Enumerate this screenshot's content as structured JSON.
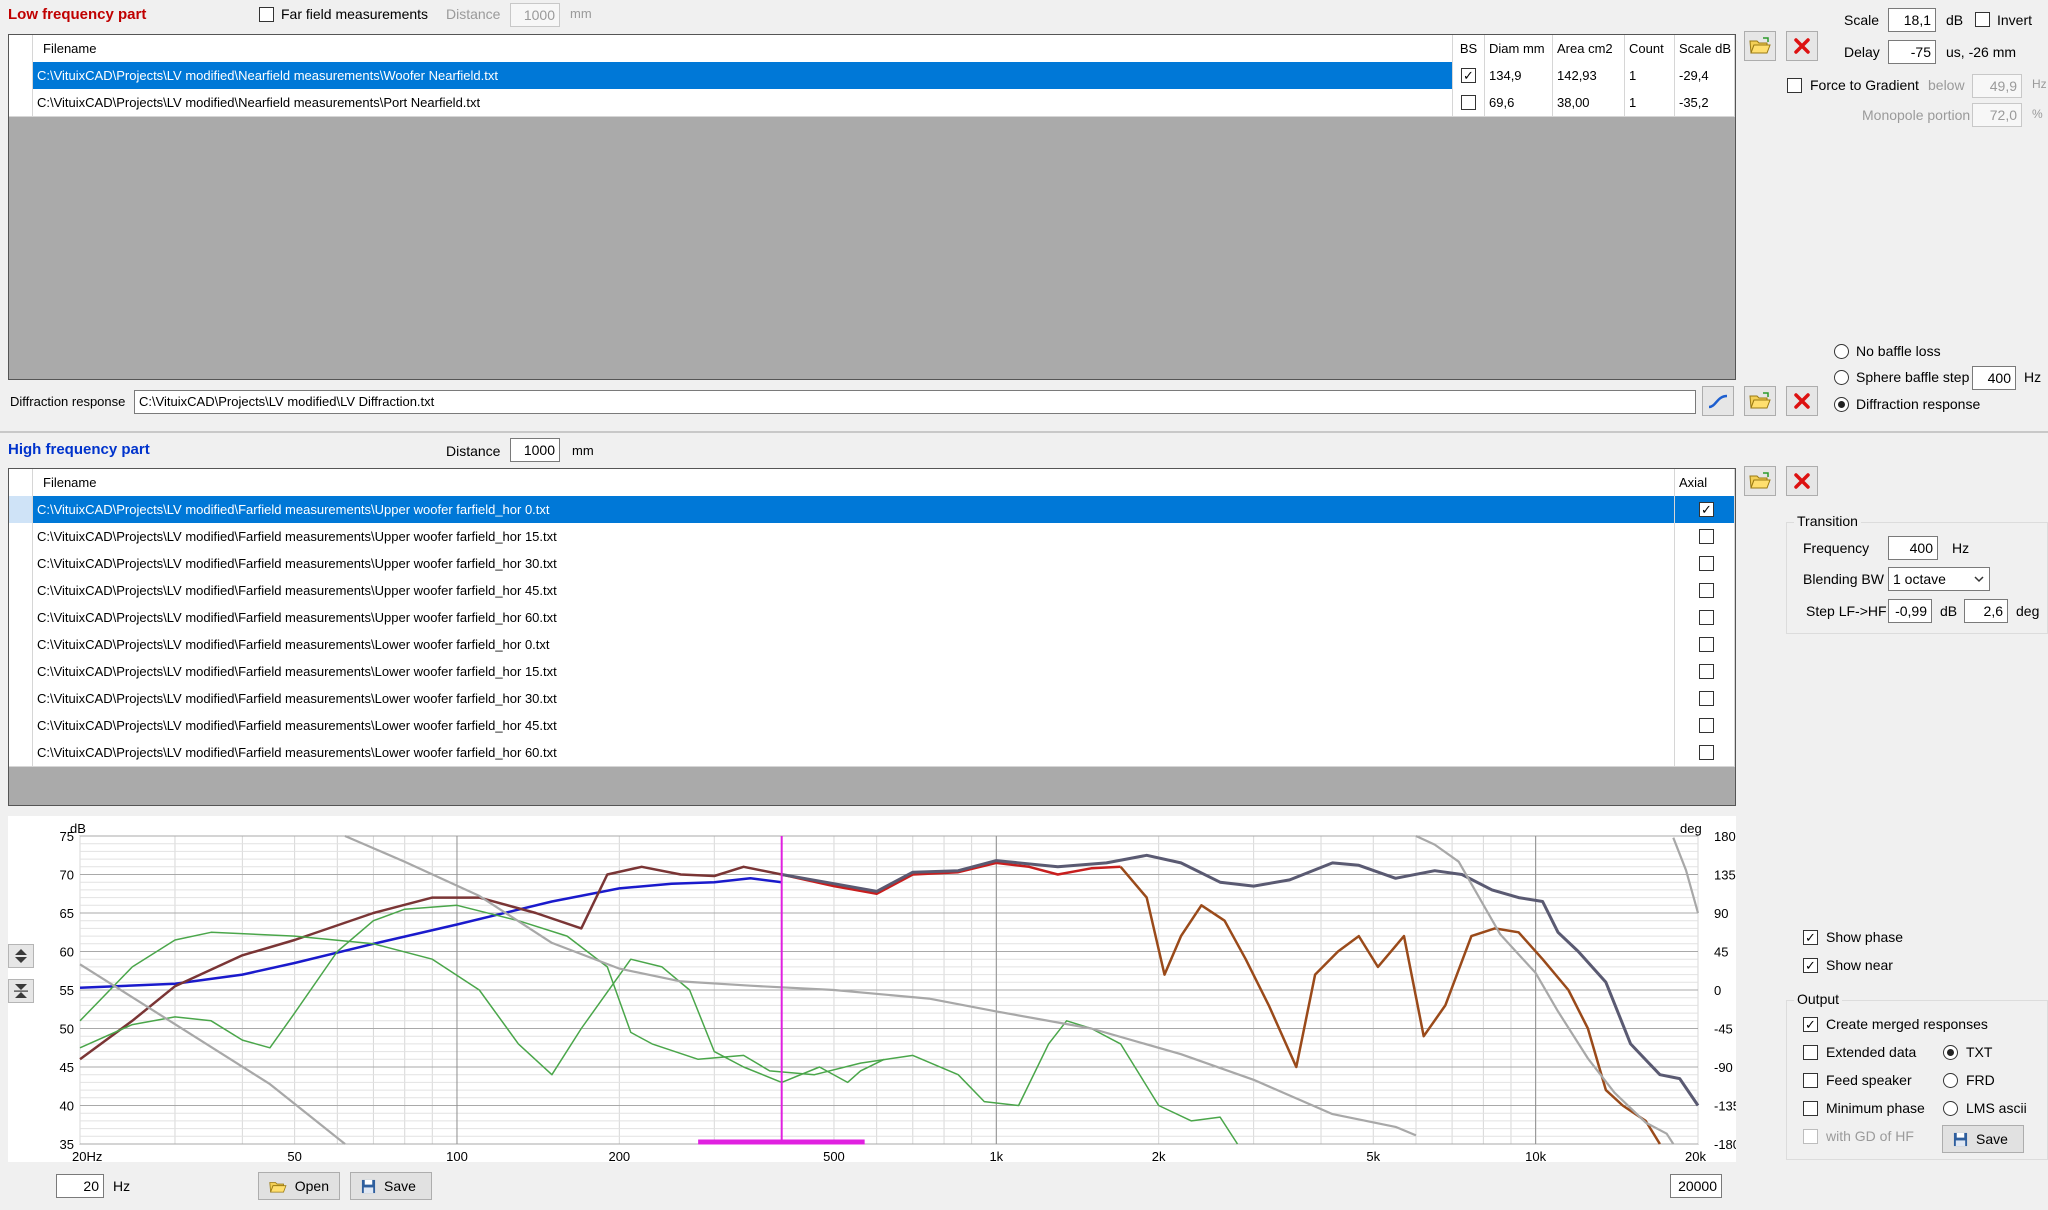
{
  "lf": {
    "title": "Low frequency part",
    "far_field_label": "Far field measurements",
    "distance_label": "Distance",
    "distance_value": "1000",
    "distance_unit": "mm",
    "columns": [
      "Filename",
      "BS",
      "Diam mm",
      "Area cm2",
      "Count",
      "Scale dB"
    ],
    "rows": [
      {
        "filename": "C:\\VituixCAD\\Projects\\LV modified\\Nearfield measurements\\Woofer Nearfield.txt",
        "bs": true,
        "diam": "134,9",
        "area": "142,93",
        "count": "1",
        "scale": "-29,4"
      },
      {
        "filename": "C:\\VituixCAD\\Projects\\LV modified\\Nearfield measurements\\Port Nearfield.txt",
        "bs": false,
        "diam": "69,6",
        "area": "38,00",
        "count": "1",
        "scale": "-35,2"
      }
    ],
    "diffraction_label": "Diffraction response",
    "diffraction_path": "C:\\VituixCAD\\Projects\\LV modified\\LV Diffraction.txt"
  },
  "scale": {
    "label": "Scale",
    "value": "18,1",
    "unit": "dB",
    "invert_label": "Invert",
    "delay_label": "Delay",
    "delay_value": "-75",
    "delay_unit": "us, -26 mm",
    "force_gradient_label": "Force to Gradient",
    "below_label": "below",
    "below_value": "49,9",
    "below_unit": "Hz",
    "monopole_label": "Monopole portion",
    "monopole_value": "72,0",
    "monopole_unit": "%"
  },
  "baffle": {
    "options": [
      "No baffle loss",
      "Sphere baffle step",
      "Diffraction response"
    ],
    "selected": 2,
    "sphere_value": "400",
    "sphere_unit": "Hz"
  },
  "hf": {
    "title": "High frequency part",
    "distance_label": "Distance",
    "distance_value": "1000",
    "distance_unit": "mm",
    "columns": [
      "Filename",
      "Axial"
    ],
    "rows": [
      {
        "filename": "C:\\VituixCAD\\Projects\\LV modified\\Farfield measurements\\Upper woofer farfield_hor 0.txt",
        "axial": true
      },
      {
        "filename": "C:\\VituixCAD\\Projects\\LV modified\\Farfield measurements\\Upper woofer farfield_hor 15.txt",
        "axial": false
      },
      {
        "filename": "C:\\VituixCAD\\Projects\\LV modified\\Farfield measurements\\Upper woofer farfield_hor 30.txt",
        "axial": false
      },
      {
        "filename": "C:\\VituixCAD\\Projects\\LV modified\\Farfield measurements\\Upper woofer farfield_hor 45.txt",
        "axial": false
      },
      {
        "filename": "C:\\VituixCAD\\Projects\\LV modified\\Farfield measurements\\Upper woofer farfield_hor 60.txt",
        "axial": false
      },
      {
        "filename": "C:\\VituixCAD\\Projects\\LV modified\\Farfield measurements\\Lower woofer farfield_hor 0.txt",
        "axial": false
      },
      {
        "filename": "C:\\VituixCAD\\Projects\\LV modified\\Farfield measurements\\Lower woofer farfield_hor 15.txt",
        "axial": false
      },
      {
        "filename": "C:\\VituixCAD\\Projects\\LV modified\\Farfield measurements\\Lower woofer farfield_hor 30.txt",
        "axial": false
      },
      {
        "filename": "C:\\VituixCAD\\Projects\\LV modified\\Farfield measurements\\Lower woofer farfield_hor 45.txt",
        "axial": false
      },
      {
        "filename": "C:\\VituixCAD\\Projects\\LV modified\\Farfield measurements\\Lower woofer farfield_hor 60.txt",
        "axial": false
      }
    ]
  },
  "transition": {
    "title": "Transition",
    "frequency_label": "Frequency",
    "frequency_value": "400",
    "frequency_unit": "Hz",
    "blending_label": "Blending BW",
    "blending_value": "1 octave",
    "step_label": "Step LF->HF",
    "step_db_value": "-0,99",
    "step_db_unit": "dB",
    "step_deg_value": "2,6",
    "step_deg_unit": "deg"
  },
  "options": {
    "show_phase": "Show phase",
    "show_near": "Show near",
    "output_title": "Output",
    "create_merged": "Create merged responses",
    "extended_data": "Extended data",
    "feed_speaker": "Feed speaker",
    "minimum_phase": "Minimum phase",
    "with_gd": "with GD of HF",
    "formats": [
      "TXT",
      "FRD",
      "LMS ascii"
    ],
    "format_selected": 0,
    "save_label": "Save"
  },
  "bottom": {
    "min_freq": "20",
    "max_freq": "20000",
    "unit": "Hz",
    "open_label": "Open",
    "save_label": "Save"
  },
  "colors": {
    "selected_row": "#0078d7",
    "lf_title": "#c00000",
    "hf_title": "#0033cc"
  },
  "chart_data": {
    "type": "line",
    "x_scale": "log",
    "xlim": [
      20,
      20000
    ],
    "ylim_left": [
      35,
      75
    ],
    "ylim_right": [
      -180,
      180
    ],
    "ylabel": "dB",
    "ylabel_right": "deg",
    "x_ticks": [
      {
        "v": 20,
        "l": "20Hz"
      },
      {
        "v": 50,
        "l": "50"
      },
      {
        "v": 100,
        "l": "100"
      },
      {
        "v": 200,
        "l": "200"
      },
      {
        "v": 500,
        "l": "500"
      },
      {
        "v": 1000,
        "l": "1k"
      },
      {
        "v": 2000,
        "l": "2k"
      },
      {
        "v": 5000,
        "l": "5k"
      },
      {
        "v": 10000,
        "l": "10k"
      },
      {
        "v": 20000,
        "l": "20k"
      }
    ],
    "y_ticks_left": [
      35,
      40,
      45,
      50,
      55,
      60,
      65,
      70,
      75
    ],
    "y_ticks_right": [
      -180,
      -135,
      -90,
      -45,
      0,
      45,
      90,
      135,
      180
    ],
    "marker_freq": 400,
    "blend_range": [
      280,
      570
    ],
    "series": [
      {
        "color": "#1a1acc",
        "axis": "left",
        "width": 2.5,
        "points": [
          [
            20,
            55.3
          ],
          [
            30,
            55.8
          ],
          [
            40,
            57
          ],
          [
            50,
            58.5
          ],
          [
            70,
            61
          ],
          [
            100,
            63.5
          ],
          [
            150,
            66.5
          ],
          [
            200,
            68.2
          ],
          [
            250,
            68.8
          ],
          [
            300,
            69
          ],
          [
            350,
            69.5
          ],
          [
            400,
            69
          ]
        ]
      },
      {
        "color": "#7a3535",
        "axis": "left",
        "width": 2.5,
        "points": [
          [
            20,
            46
          ],
          [
            25,
            51
          ],
          [
            30,
            55.5
          ],
          [
            40,
            59.5
          ],
          [
            50,
            61.5
          ],
          [
            70,
            65
          ],
          [
            90,
            67
          ],
          [
            110,
            67
          ],
          [
            140,
            65
          ],
          [
            170,
            63
          ],
          [
            190,
            70
          ],
          [
            220,
            71
          ],
          [
            260,
            70
          ],
          [
            300,
            69.8
          ],
          [
            340,
            71
          ],
          [
            400,
            70
          ]
        ]
      },
      {
        "color": "#c81e1e",
        "axis": "left",
        "width": 2.5,
        "points": [
          [
            400,
            70
          ],
          [
            500,
            68.5
          ],
          [
            600,
            67.5
          ],
          [
            700,
            70
          ],
          [
            850,
            70.3
          ],
          [
            1000,
            71.5
          ],
          [
            1150,
            71
          ],
          [
            1300,
            70
          ],
          [
            1500,
            70.8
          ],
          [
            1700,
            71
          ]
        ]
      },
      {
        "color": "#5a5a72",
        "axis": "left",
        "width": 3,
        "points": [
          [
            400,
            70
          ],
          [
            500,
            68.8
          ],
          [
            600,
            67.8
          ],
          [
            700,
            70.3
          ],
          [
            850,
            70.5
          ],
          [
            1000,
            71.8
          ],
          [
            1300,
            71
          ],
          [
            1600,
            71.5
          ],
          [
            1900,
            72.5
          ],
          [
            2200,
            71.5
          ],
          [
            2600,
            69
          ],
          [
            3000,
            68.5
          ],
          [
            3500,
            69.3
          ],
          [
            4200,
            71.5
          ],
          [
            4700,
            71.2
          ],
          [
            5500,
            69.5
          ],
          [
            6500,
            70.5
          ],
          [
            7300,
            70
          ],
          [
            8300,
            68
          ],
          [
            9300,
            67
          ],
          [
            10300,
            66.5
          ],
          [
            11000,
            62.5
          ],
          [
            12000,
            60
          ],
          [
            13500,
            56
          ],
          [
            15000,
            48
          ],
          [
            17000,
            44
          ],
          [
            18500,
            43.5
          ],
          [
            20000,
            40
          ]
        ]
      },
      {
        "color": "#9a4a1a",
        "axis": "left",
        "width": 2.5,
        "points": [
          [
            1700,
            71
          ],
          [
            1900,
            67
          ],
          [
            2050,
            57
          ],
          [
            2200,
            62
          ],
          [
            2400,
            66
          ],
          [
            2650,
            64
          ],
          [
            2900,
            59
          ],
          [
            3200,
            53
          ],
          [
            3600,
            45
          ],
          [
            3900,
            57
          ],
          [
            4300,
            60
          ],
          [
            4700,
            62
          ],
          [
            5100,
            58
          ],
          [
            5700,
            62
          ],
          [
            6200,
            49
          ],
          [
            6800,
            53
          ],
          [
            7600,
            62
          ],
          [
            8400,
            63
          ],
          [
            9300,
            62.5
          ],
          [
            10300,
            59
          ],
          [
            11500,
            55
          ],
          [
            12500,
            50
          ],
          [
            13500,
            42
          ],
          [
            14500,
            40
          ],
          [
            16000,
            38
          ],
          [
            17000,
            35
          ]
        ]
      },
      {
        "color": "#4aa64a",
        "axis": "left",
        "width": 1.5,
        "points": [
          [
            20,
            47.5
          ],
          [
            25,
            50.5
          ],
          [
            30,
            51.5
          ],
          [
            35,
            51
          ],
          [
            40,
            48.5
          ],
          [
            45,
            47.5
          ],
          [
            50,
            52
          ],
          [
            60,
            60
          ],
          [
            70,
            64
          ],
          [
            80,
            65.5
          ],
          [
            100,
            66
          ],
          [
            130,
            64
          ],
          [
            160,
            62
          ],
          [
            190,
            58
          ],
          [
            210,
            49.5
          ],
          [
            230,
            48
          ],
          [
            280,
            46
          ],
          [
            340,
            46.5
          ],
          [
            380,
            44.5
          ],
          [
            460,
            44
          ],
          [
            560,
            45.5
          ],
          [
            700,
            46.5
          ],
          [
            850,
            44
          ],
          [
            950,
            40.5
          ],
          [
            1100,
            40
          ],
          [
            1250,
            48
          ],
          [
            1350,
            51
          ],
          [
            1500,
            50
          ],
          [
            1700,
            48
          ],
          [
            2000,
            40
          ],
          [
            2300,
            38
          ],
          [
            2600,
            38.5
          ],
          [
            2800,
            35
          ]
        ]
      },
      {
        "color": "#4aa64a",
        "axis": "left",
        "width": 1.5,
        "points": [
          [
            20,
            51
          ],
          [
            25,
            58
          ],
          [
            30,
            61.5
          ],
          [
            35,
            62.5
          ],
          [
            50,
            62
          ],
          [
            70,
            61
          ],
          [
            90,
            59
          ],
          [
            110,
            55
          ],
          [
            130,
            48
          ],
          [
            150,
            44
          ],
          [
            170,
            50
          ],
          [
            210,
            59
          ],
          [
            240,
            58
          ],
          [
            270,
            55
          ],
          [
            300,
            47
          ],
          [
            340,
            45
          ],
          [
            400,
            43
          ],
          [
            470,
            45
          ],
          [
            530,
            43
          ],
          [
            560,
            44.5
          ],
          [
            620,
            46
          ]
        ]
      },
      {
        "color": "#a8a8a8",
        "axis": "right",
        "width": 2.2,
        "points": [
          [
            20,
            30
          ],
          [
            30,
            -40
          ],
          [
            45,
            -110
          ],
          [
            62,
            -180
          ],
          [
            62,
            180
          ],
          [
            80,
            150
          ],
          [
            110,
            110
          ],
          [
            150,
            55
          ],
          [
            200,
            25
          ],
          [
            260,
            10
          ],
          [
            350,
            5
          ],
          [
            500,
            0
          ],
          [
            750,
            -10
          ],
          [
            1000,
            -25
          ],
          [
            1500,
            -45
          ],
          [
            2200,
            -75
          ],
          [
            3000,
            -105
          ],
          [
            4200,
            -145
          ],
          [
            5500,
            -160
          ],
          [
            6000,
            -170
          ],
          [
            6000,
            180
          ],
          [
            6500,
            170
          ],
          [
            7200,
            150
          ],
          [
            8600,
            65
          ],
          [
            10000,
            20
          ],
          [
            11000,
            -25
          ],
          [
            12500,
            -80
          ],
          [
            14000,
            -120
          ],
          [
            16000,
            -155
          ],
          [
            17500,
            -168
          ],
          [
            18000,
            -180
          ],
          [
            18000,
            178
          ],
          [
            19000,
            140
          ],
          [
            20000,
            90
          ]
        ]
      }
    ]
  }
}
